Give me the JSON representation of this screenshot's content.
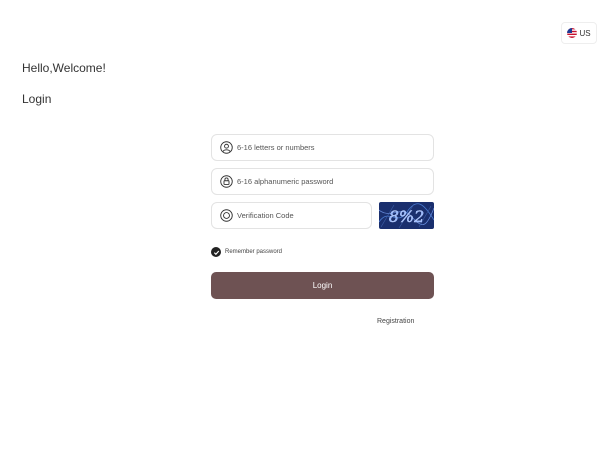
{
  "language": {
    "label": "US",
    "flag_icon": "us-flag-icon"
  },
  "header": {
    "welcome": "Hello,Welcome!",
    "title": "Login"
  },
  "form": {
    "username": {
      "placeholder": "6-16 letters or numbers",
      "icon": "user-icon"
    },
    "password": {
      "placeholder": "6-16 alphanumeric password",
      "icon": "lock-icon"
    },
    "verification": {
      "placeholder": "Verification Code",
      "icon": "shield-icon",
      "captcha_text": "8%2"
    },
    "remember": {
      "label": "Remember password",
      "checked": true
    },
    "submit_label": "Login",
    "register_label": "Registration"
  },
  "colors": {
    "button": "#6e5253",
    "captcha_bg": "#1a2f6e",
    "captcha_text": "#8fb3ff"
  }
}
